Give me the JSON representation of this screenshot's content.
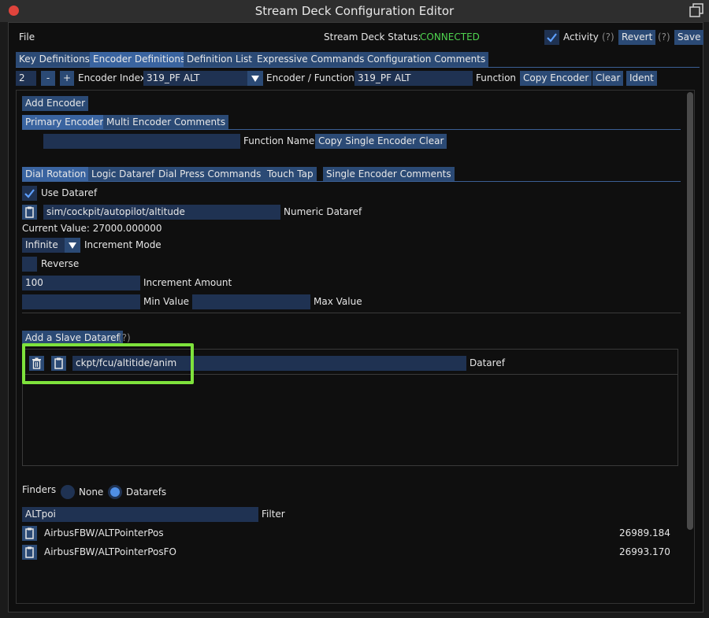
{
  "window": {
    "title": "Stream Deck Configuration Editor"
  },
  "menu": {
    "file": "File",
    "status_label": "Stream Deck Status:",
    "status_value": "CONNECTED",
    "activity_label": "Activity",
    "help_1": "(?)",
    "revert": "Revert",
    "help_2": "(?)",
    "save": "Save"
  },
  "main_tabs": [
    "Key Definitions",
    "Encoder Definitions",
    "Definition List",
    "Expressive Commands",
    "Configuration Comments"
  ],
  "encoder_bar": {
    "count": "2",
    "minus": "-",
    "plus": "+",
    "index_label": "Encoder Index",
    "index_value": "319_PF ALT",
    "function_label": "Encoder / Function",
    "function_value": "319_PF ALT",
    "function_text": "Function",
    "copy_encoder": "Copy Encoder",
    "clear": "Clear",
    "ident": "Ident"
  },
  "add_encoder": "Add Encoder",
  "sub_tabs": [
    "Primary Encoder",
    "Multi Encoder Comments"
  ],
  "function_name": {
    "value": "",
    "label": "Function Name",
    "copy_single": "Copy Single Encoder",
    "clear": "Clear"
  },
  "dial_tabs": [
    "Dial Rotation",
    "Logic Dataref",
    "Dial Press Commands",
    "Touch Tap",
    "Single Encoder Comments"
  ],
  "dial_rotation": {
    "use_dataref_label": "Use Dataref",
    "dataref_value": "sim/cockpit/autopilot/altitude",
    "numeric_dataref_label": "Numeric Dataref",
    "current_value": "Current Value: 27000.000000",
    "increment_mode_value": "Infinite",
    "increment_mode_label": "Increment Mode",
    "reverse_label": "Reverse",
    "increment_amount_value": "100",
    "increment_amount_label": "Increment Amount",
    "min_value": "",
    "min_label": "Min Value",
    "max_value": "",
    "max_label": "Max Value"
  },
  "slave": {
    "add_button": "Add a Slave Dataref",
    "help": "(?)",
    "rows": [
      {
        "value": "ckpt/fcu/altitide/anim",
        "label": "Dataref"
      }
    ]
  },
  "finders": {
    "label": "Finders",
    "options": [
      "None",
      "Datarefs"
    ],
    "selected": "Datarefs",
    "filter_value": "ALTpoi",
    "filter_label": "Filter",
    "results": [
      {
        "name": "AirbusFBW/ALTPointerPos",
        "value": "26989.184"
      },
      {
        "name": "AirbusFBW/ALTPointerPosFO",
        "value": "26993.170"
      }
    ]
  },
  "colors": {
    "accent": "#2b4a75",
    "connected": "#4fd44f",
    "highlight": "#7ee23c",
    "close": "#e0443c"
  }
}
